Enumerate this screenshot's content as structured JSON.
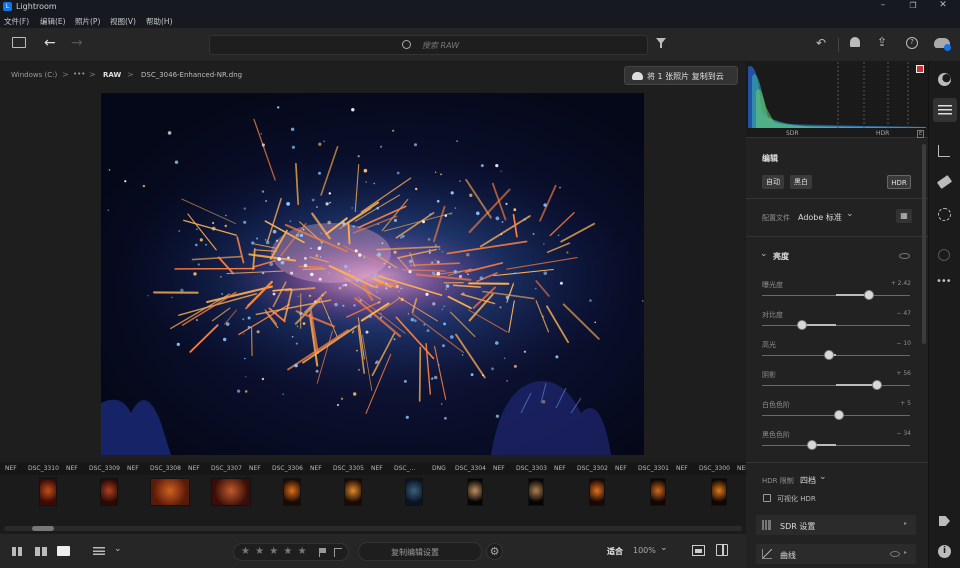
{
  "app": {
    "title": "Lightroom"
  },
  "menu": [
    "文件(F)",
    "编辑(E)",
    "照片(P)",
    "视图(V)",
    "帮助(H)"
  ],
  "toolbar": {
    "search_placeholder": "搜索 RAW"
  },
  "breadcrumb": {
    "drive": "Windows (C:)",
    "more": "•••",
    "folder": "RAW",
    "file": "DSC_3046-Enhanced-NR.dng",
    "sep": ">"
  },
  "copy_button": "将 1 张照片 复制到云",
  "histogram": {
    "sdr": "SDR",
    "hdr": "HDR",
    "hdr_badge": "E"
  },
  "edit": {
    "title": "编辑",
    "auto": "自动",
    "bw": "黑白",
    "hdr": "HDR",
    "profile_label": "配置文件",
    "profile_value": "Adobe 标准",
    "light_title": "亮度",
    "sliders": [
      {
        "label": "曝光度",
        "value": "+ 2.42",
        "level": 0.72
      },
      {
        "label": "对比度",
        "value": "− 47",
        "level": 0.27
      },
      {
        "label": "高光",
        "value": "− 10",
        "level": 0.45
      },
      {
        "label": "阴影",
        "value": "+ 56",
        "level": 0.78
      },
      {
        "label": "白色色阶",
        "value": "+ 5",
        "level": 0.52
      },
      {
        "label": "黑色色阶",
        "value": "− 34",
        "level": 0.34
      }
    ],
    "hdr_limit_label": "HDR 限制",
    "hdr_limit_value": "四档",
    "visualize_hdr": "可视化 HDR",
    "sdr_settings": "SDR 设置",
    "curve": "曲线"
  },
  "filmstrip": [
    {
      "name": "DSC_3310",
      "type": "NEF"
    },
    {
      "name": "DSC_3309",
      "type": "NEF"
    },
    {
      "name": "DSC_3308",
      "type": "NEF"
    },
    {
      "name": "DSC_3307",
      "type": "NEF"
    },
    {
      "name": "DSC_3306",
      "type": "NEF"
    },
    {
      "name": "DSC_3305",
      "type": "NEF"
    },
    {
      "name": "DSC_...",
      "type": "DNG"
    },
    {
      "name": "DSC_3304",
      "type": "NEF"
    },
    {
      "name": "DSC_3303",
      "type": "NEF"
    },
    {
      "name": "DSC_3302",
      "type": "NEF"
    },
    {
      "name": "DSC_3301",
      "type": "NEF"
    },
    {
      "name": "DSC_3300",
      "type": "NEF"
    }
  ],
  "filmstrip_lead_type": "NEF",
  "bottom": {
    "stars": "★ ★ ★ ★ ★",
    "copy_settings": "复制编辑设置",
    "fit": "适合",
    "zoom": "100%"
  },
  "colors": {
    "accent": "#1473e6",
    "panel": "#222222",
    "toolbar": "#262626"
  },
  "icons": {
    "back": "arrow-left-icon",
    "search": "search-icon",
    "filter": "filter-icon",
    "undo": "undo-icon",
    "bell": "bell-icon",
    "share": "share-icon",
    "help": "help-icon",
    "cloud": "cloud-icon"
  }
}
